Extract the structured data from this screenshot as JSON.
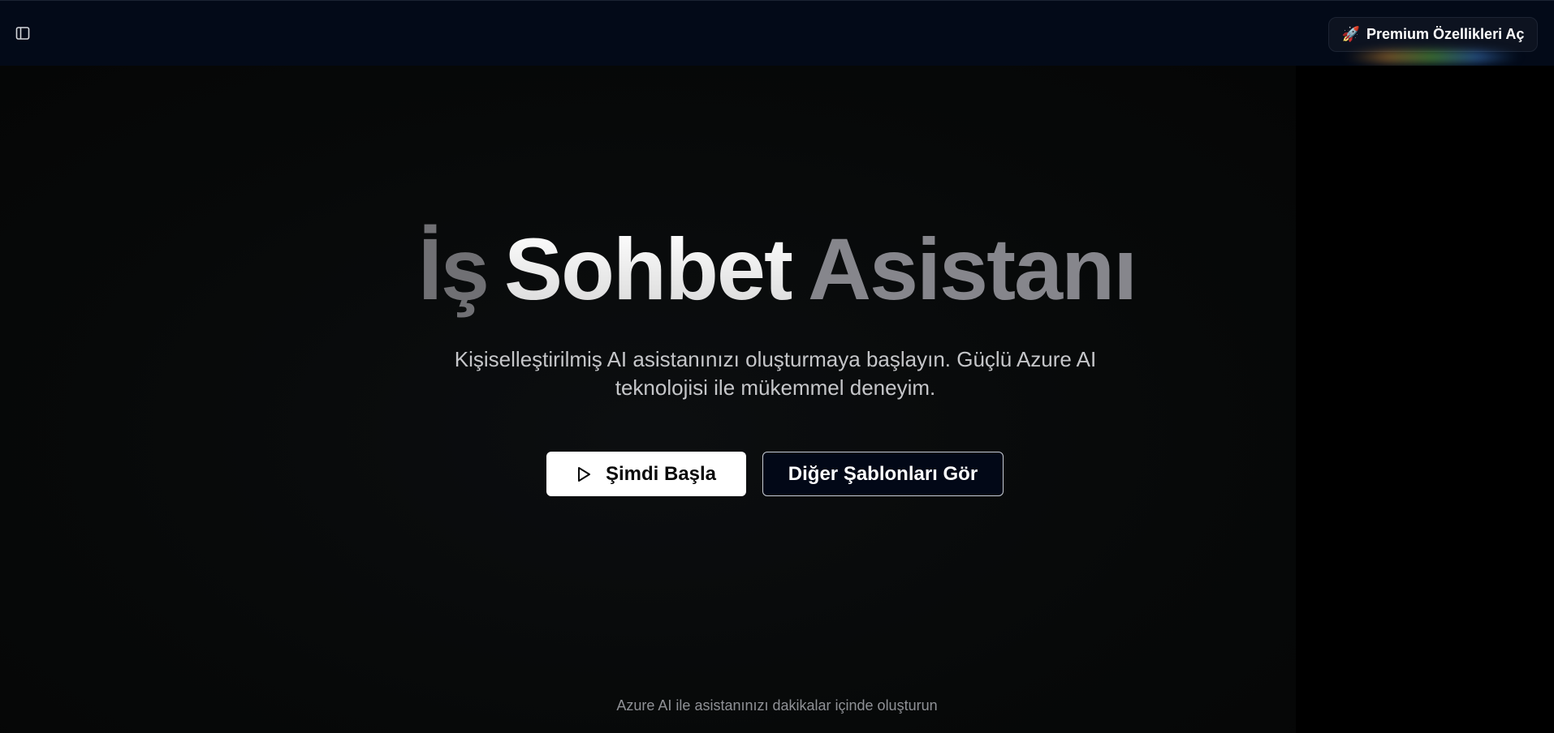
{
  "topbar": {
    "sidebar_toggle_icon": "sidebar-panel-icon",
    "premium_button": {
      "icon": "rocket-icon",
      "emoji": "🚀",
      "label": "Premium Özellikleri Aç"
    }
  },
  "hero": {
    "title_words": [
      "İş",
      "Sohbet",
      "Asistanı"
    ],
    "subtitle": "Kişiselleştirilmiş AI asistanınızı oluşturmaya başlayın. Güçlü Azure AI teknolojisi ile mükemmel deneyim.",
    "primary_button": {
      "icon": "play-icon",
      "label": "Şimdi Başla"
    },
    "secondary_button": {
      "label": "Diğer Şablonları Gör"
    }
  },
  "footer": {
    "note": "Azure AI ile asistanınızı dakikalar içinde oluşturun"
  },
  "colors": {
    "topbar_bg": "#030a18",
    "page_bg": "#070909",
    "primary_button_bg": "#ffffff",
    "secondary_button_bg": "#020817"
  }
}
